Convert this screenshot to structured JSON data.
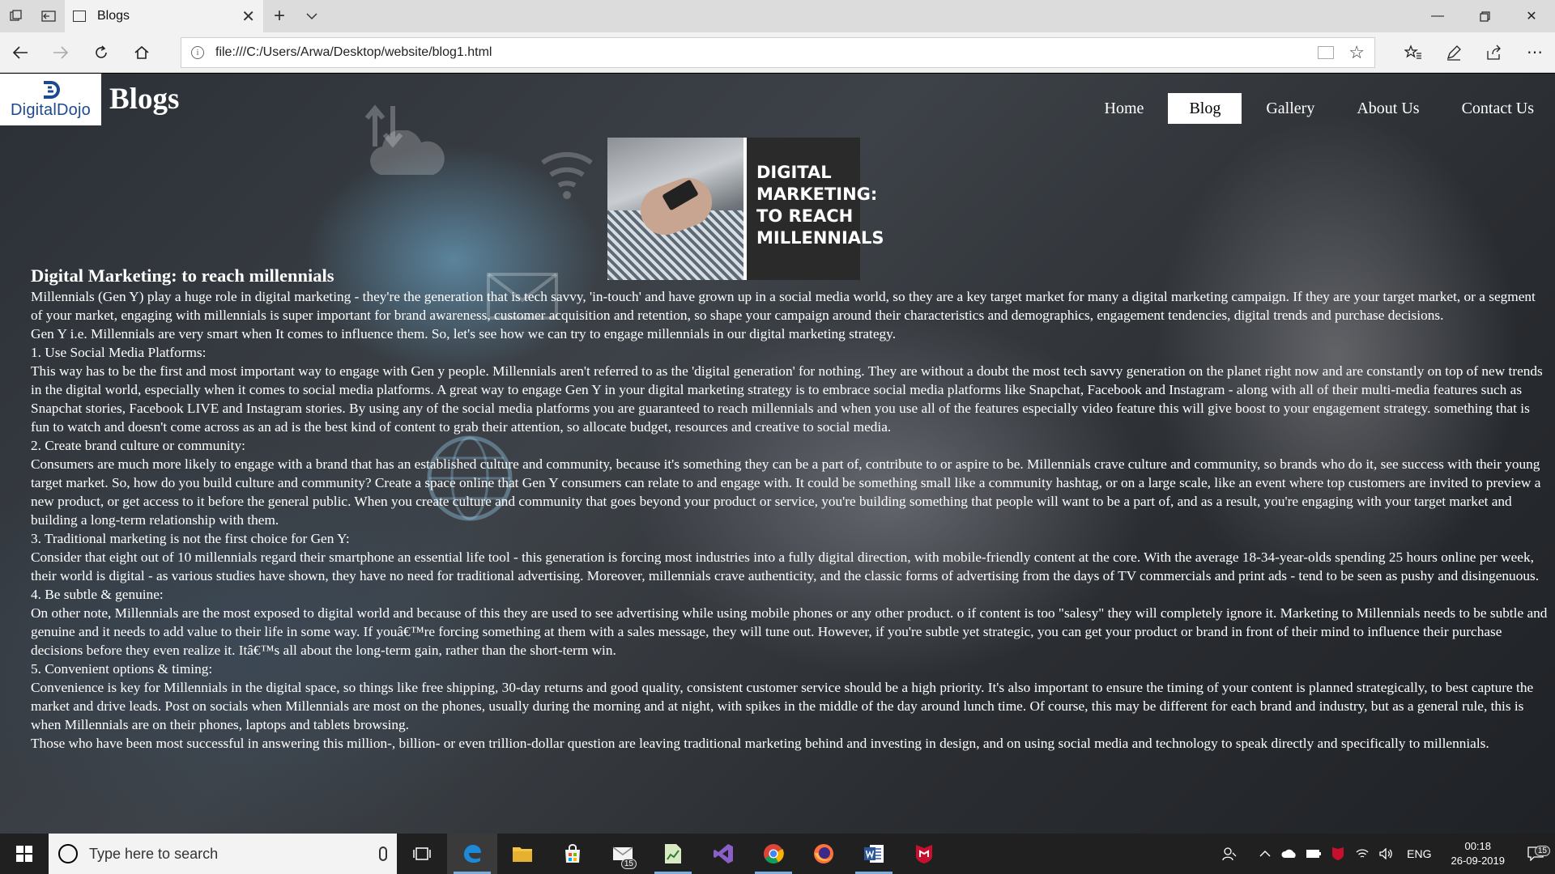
{
  "browser": {
    "tab_title": "Blogs",
    "url": "file:///C:/Users/Arwa/Desktop/website/blog1.html"
  },
  "site": {
    "logo_text": "DigitalDojo",
    "title": "Blogs",
    "nav": [
      {
        "label": "Home",
        "active": false
      },
      {
        "label": "Blog",
        "active": true
      },
      {
        "label": "Gallery",
        "active": false
      },
      {
        "label": "About Us",
        "active": false
      },
      {
        "label": "Contact Us",
        "active": false
      }
    ],
    "hero_text": "DIGITAL MARKETING: TO REACH MILLENNIALS"
  },
  "article": {
    "heading": "Digital Marketing: to reach millennials",
    "paragraphs": [
      "Millennials (Gen Y) play a huge role in digital marketing - they're the generation that is tech savvy, 'in-touch' and have grown up in a social media world, so they are a key target market for many a digital marketing campaign. If they are your target market, or a segment of your market, engaging with millennials is super important for brand awareness, customer acquisition and retention, so shape your campaign around their characteristics and demographics, engagement tendencies, digital trends and purchase decisions.",
      "Gen Y i.e. Millennials are very smart when It comes to influence them. So, let's see how we can try to engage millennials in our digital marketing strategy.",
      "1. Use Social Media Platforms:",
      "This way has to be the first and most important way to engage with Gen y people. Millennials aren't referred to as the 'digital generation' for nothing. They are without a doubt the most tech savvy generation on the planet right now and are constantly on top of new trends in the digital world, especially when it comes to social media platforms. A great way to engage Gen Y in your digital marketing strategy is to embrace social media platforms like Snapchat, Facebook and Instagram - along with all of their multi-media features such as Snapchat stories, Facebook LIVE and Instagram stories. By using any of the social media platforms you are guaranteed to reach millennials and when you use all of the features especially video feature this will give boost to your engagement strategy. something that is fun to watch and doesn't come across as an ad is the best kind of content to grab their attention, so allocate budget, resources and creative to social media.",
      "2. Create brand culture or community:",
      "Consumers are much more likely to engage with a brand that has an established culture and community, because it's something they can be a part of, contribute to or aspire to be. Millennials crave culture and community, so brands who do it, see success with their young target market. So, how do you build culture and community? Create a space online that Gen Y consumers can relate to and engage with. It could be something small like a community hashtag, or on a large scale, like an event where top customers are invited to preview a new product, or get access to it before the general public. When you create culture and community that goes beyond your product or service, you're building something that people will want to be a part of, and as a result, you're engaging with your target market and building a long-term relationship with them.",
      "3. Traditional marketing is not the first choice for Gen Y:",
      "Consider that eight out of 10 millennials regard their smartphone an essential life tool - this generation is forcing most industries into a fully digital direction, with mobile-friendly content at the core. With the average 18-34-year-olds spending 25 hours online per week, their world is digital - as various studies have shown, they have no need for traditional advertising. Moreover, millennials crave authenticity, and the classic forms of advertising from the days of TV commercials and print ads - tend to be seen as pushy and disingenuous.",
      "4. Be subtle & genuine:",
      "On other note, Millennials are the most exposed to digital world and because of this they are used to see advertising while using mobile phones or any other product. o if content is too \"salesy\" they will completely ignore it. Marketing to Millennials needs to be subtle and genuine and it needs to add value to their life in some way. If youâ€™re forcing something at them with a sales message, they will tune out. However, if you're subtle yet strategic, you can get your product or brand in front of their mind to influence their purchase decisions before they even realize it. Itâ€™s all about the long-term gain, rather than the short-term win.",
      "5. Convenient options & timing:",
      "Convenience is key for Millennials in the digital space, so things like free shipping, 30-day returns and good quality, consistent customer service should be a high priority. It's also important to ensure the timing of your content is planned strategically, to best capture the market and drive leads. Post on socials when Millennials are most on the phones, usually during the morning and at night, with spikes in the middle of the day around lunch time. Of course, this may be different for each brand and industry, but as a general rule, this is when Millennials are on their phones, laptops and tablets browsing.",
      "Those who have been most successful in answering this million-, billion- or even trillion-dollar question are leaving traditional marketing behind and investing in design, and on using social media and technology to speak directly and specifically to millennials."
    ]
  },
  "taskbar": {
    "search_placeholder": "Type here to search",
    "mail_badge": "15",
    "language": "ENG",
    "time": "00:18",
    "date": "26-09-2019",
    "notification_badge": "15"
  },
  "colors": {
    "edge_blue": "#1c8ad8",
    "logo_blue": "#1d4a8f",
    "vs_purple": "#8a5fc8",
    "word_blue": "#2b579a",
    "mcafee_red": "#c8102e"
  }
}
